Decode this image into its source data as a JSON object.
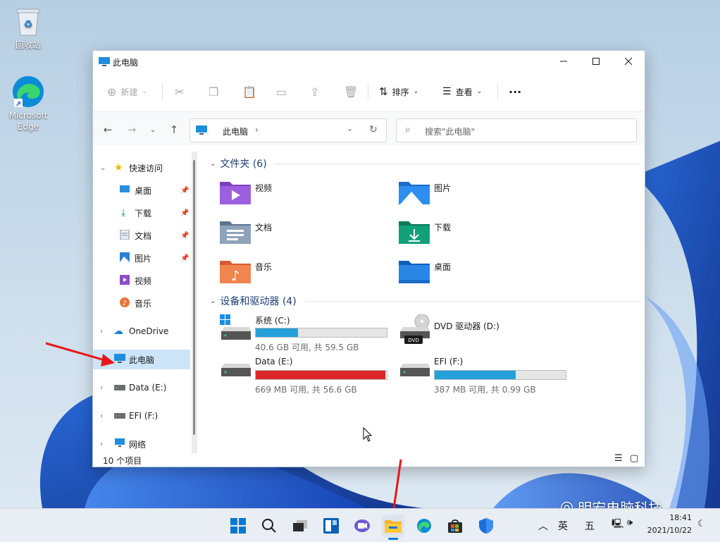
{
  "desktop": {
    "icons": [
      {
        "label": "回收站"
      },
      {
        "label": "Microsoft Edge"
      }
    ]
  },
  "window": {
    "title": "此电脑",
    "controls": {
      "minimize": "—",
      "maximize": "☐",
      "close": "✕"
    }
  },
  "toolbar": {
    "new_label": "新建",
    "sort_label": "排序",
    "view_label": "查看",
    "more_label": "···"
  },
  "address": {
    "path": "此电脑",
    "search_placeholder": "搜索\"此电脑\""
  },
  "nav": {
    "quick_access": "快速访问",
    "items": [
      {
        "label": "桌面",
        "icon": "desktop-icon"
      },
      {
        "label": "下载",
        "icon": "download-icon"
      },
      {
        "label": "文档",
        "icon": "document-icon"
      },
      {
        "label": "图片",
        "icon": "picture-icon"
      },
      {
        "label": "视频",
        "icon": "video-icon"
      },
      {
        "label": "音乐",
        "icon": "music-icon"
      }
    ],
    "onedrive": "OneDrive",
    "this_pc": "此电脑",
    "data_e": "Data (E:)",
    "efi_f": "EFI (F:)",
    "network": "网络"
  },
  "content": {
    "folders_header": "文件夹 (6)",
    "folders": [
      {
        "name": "视频",
        "icon": "video-folder-icon"
      },
      {
        "name": "图片",
        "icon": "picture-folder-icon"
      },
      {
        "name": "文档",
        "icon": "document-folder-icon"
      },
      {
        "name": "下载",
        "icon": "download-folder-icon"
      },
      {
        "name": "音乐",
        "icon": "music-folder-icon"
      },
      {
        "name": "桌面",
        "icon": "desktop-folder-icon"
      }
    ],
    "drives_header": "设备和驱动器 (4)",
    "drives": [
      {
        "name": "系统 (C:)",
        "info": "40.6 GB 可用, 共 59.5 GB",
        "used_fraction": 0.32,
        "color": "#26a0da"
      },
      {
        "name": "DVD 驱动器 (D:)",
        "info": "",
        "used_fraction": 0,
        "color": "#26a0da"
      },
      {
        "name": "Data (E:)",
        "info": "669 MB 可用, 共 56.6 GB",
        "used_fraction": 0.99,
        "color": "#da2626"
      },
      {
        "name": "EFI (F:)",
        "info": "387 MB 可用, 共 0.99 GB",
        "used_fraction": 0.62,
        "color": "#26a0da"
      }
    ],
    "dvd_badge": "DVD"
  },
  "status": {
    "count": "10 个项目"
  },
  "taskbar": {
    "lang1": "英",
    "lang2": "五",
    "time": "18:41",
    "date": "2021/10/22"
  },
  "watermark": "明宏电脑科技"
}
